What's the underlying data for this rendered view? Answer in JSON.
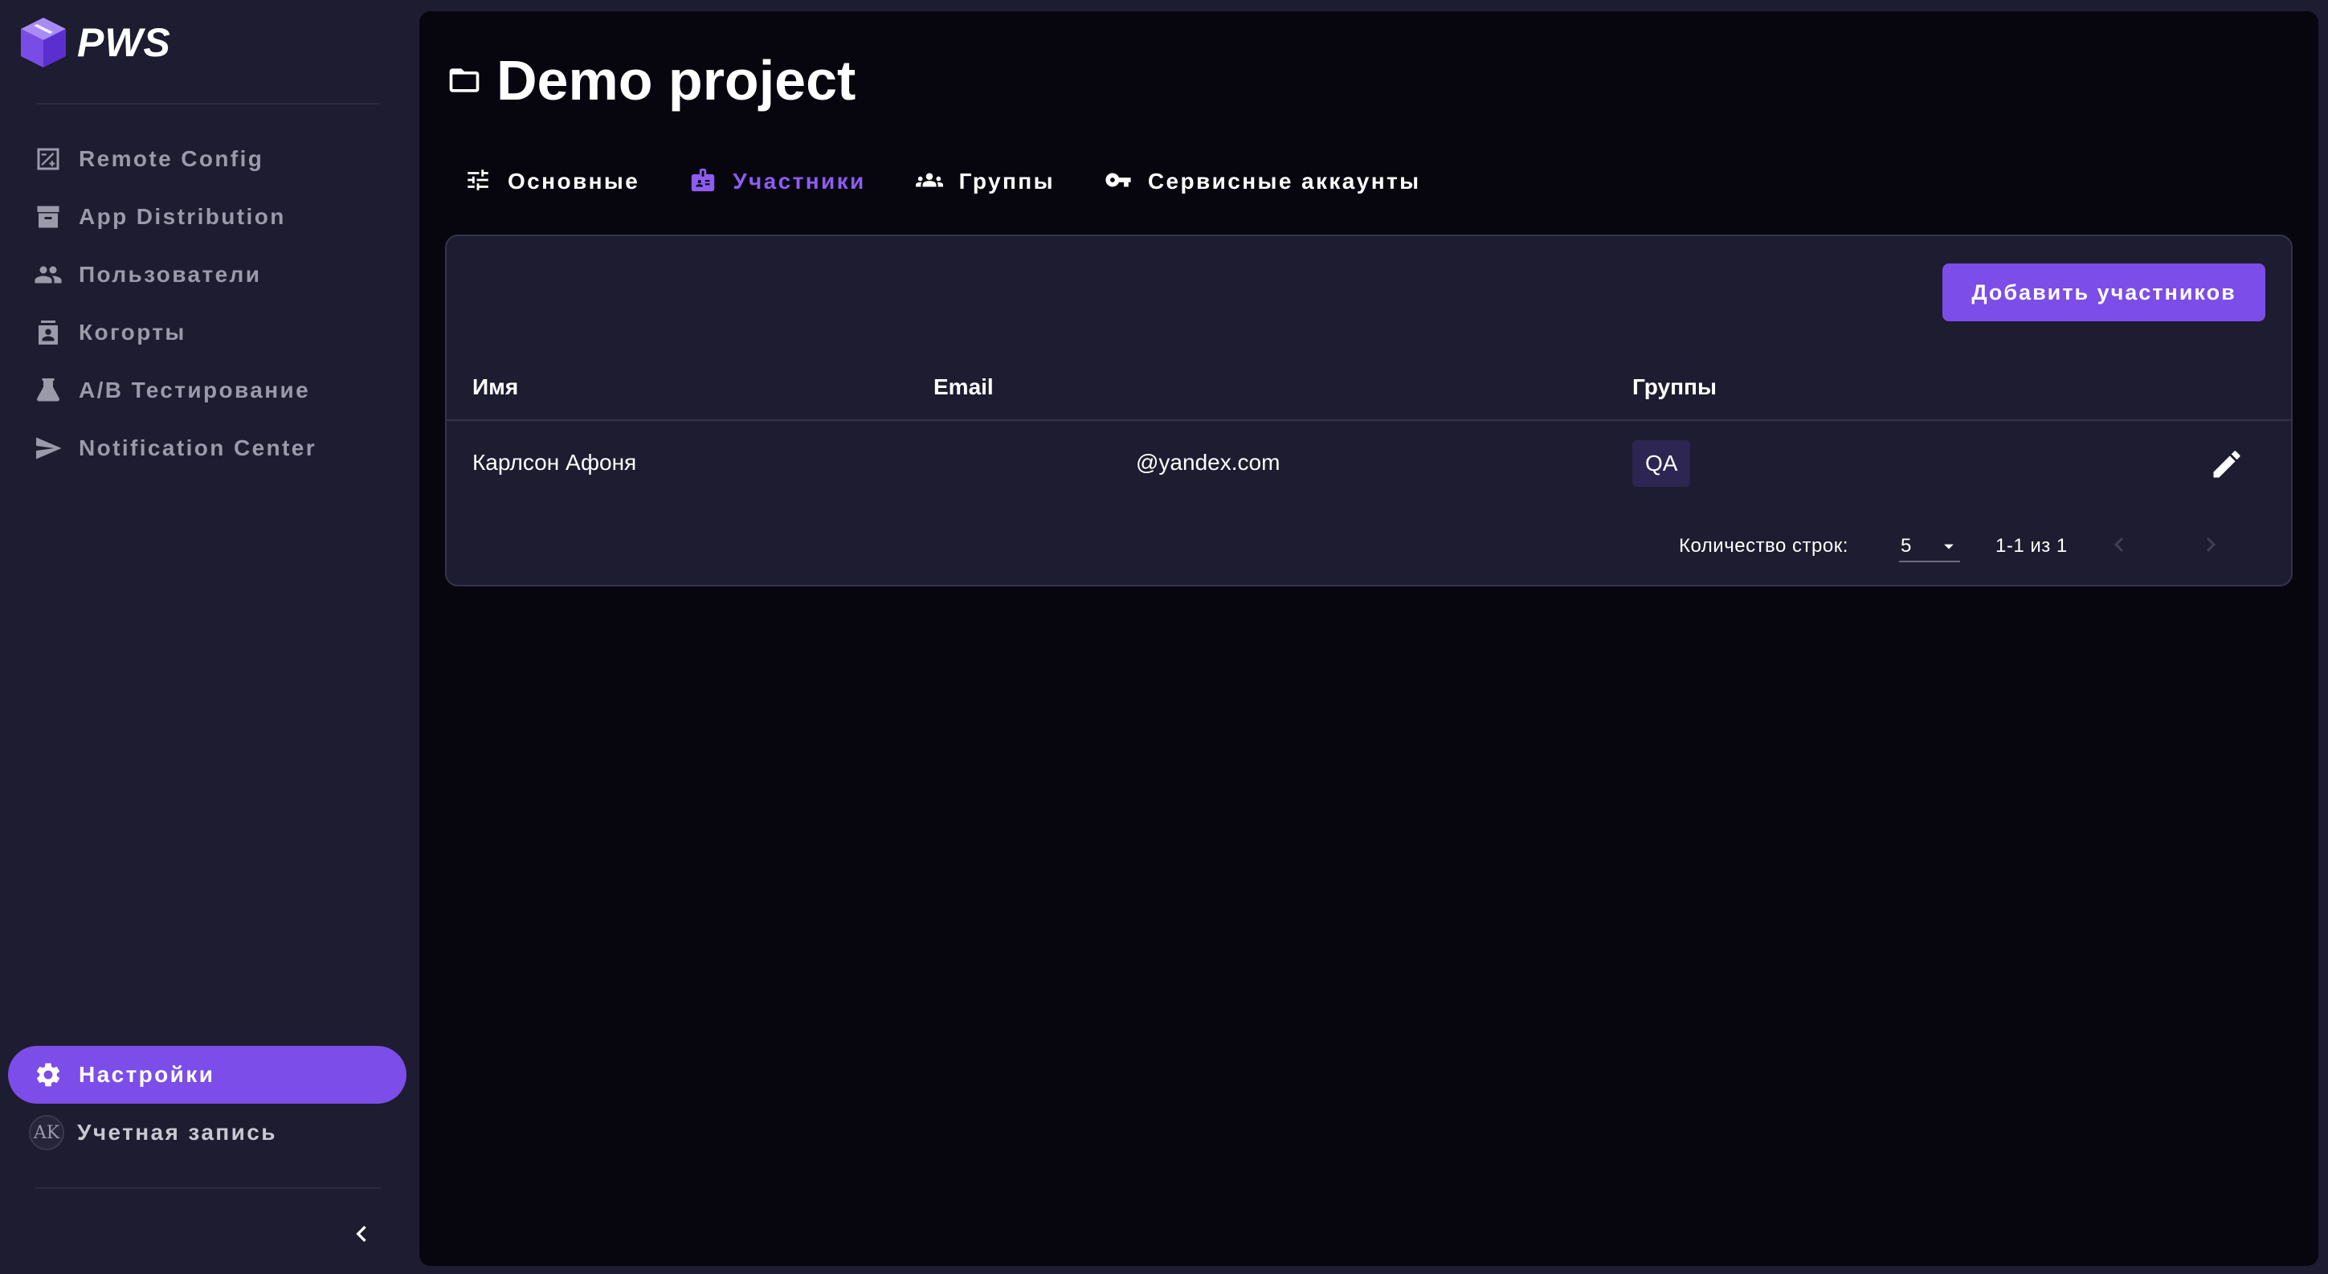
{
  "app": {
    "name": "PWS"
  },
  "sidebar": {
    "items": [
      {
        "label": "Remote Config",
        "icon": "remote-config-icon"
      },
      {
        "label": "App Distribution",
        "icon": "archive-icon"
      },
      {
        "label": "Пользователи",
        "icon": "people-icon"
      },
      {
        "label": "Когорты",
        "icon": "badge-icon"
      },
      {
        "label": "A/B Тестирование",
        "icon": "flask-icon"
      },
      {
        "label": "Notification Center",
        "icon": "send-icon"
      }
    ],
    "settings": {
      "label": "Настройки",
      "icon": "gear-icon"
    },
    "account": {
      "initials": "AK",
      "label": "Учетная запись"
    }
  },
  "page": {
    "title": "Demo project"
  },
  "tabs": [
    {
      "label": "Основные",
      "icon": "sliders-icon",
      "active": false
    },
    {
      "label": "Участники",
      "icon": "id-badge-icon",
      "active": true
    },
    {
      "label": "Группы",
      "icon": "groups-icon",
      "active": false
    },
    {
      "label": "Сервисные аккаунты",
      "icon": "key-icon",
      "active": false
    }
  ],
  "members": {
    "add_button": "Добавить участников",
    "columns": {
      "name": "Имя",
      "email": "Email",
      "groups": "Группы"
    },
    "rows": [
      {
        "name": "Карлсон Афоня",
        "email": "@yandex.com",
        "groups": [
          "QA"
        ]
      }
    ],
    "pagination": {
      "rows_label": "Количество строк:",
      "rows_per_page": "5",
      "range": "1-1 из 1"
    }
  },
  "colors": {
    "accent": "#7c4de8",
    "accent_text": "#8e5cf0",
    "sidebar_bg": "#1d1c30",
    "main_bg": "#07060f",
    "card_bg": "#1d1c30",
    "chip_bg": "#2d2552"
  }
}
